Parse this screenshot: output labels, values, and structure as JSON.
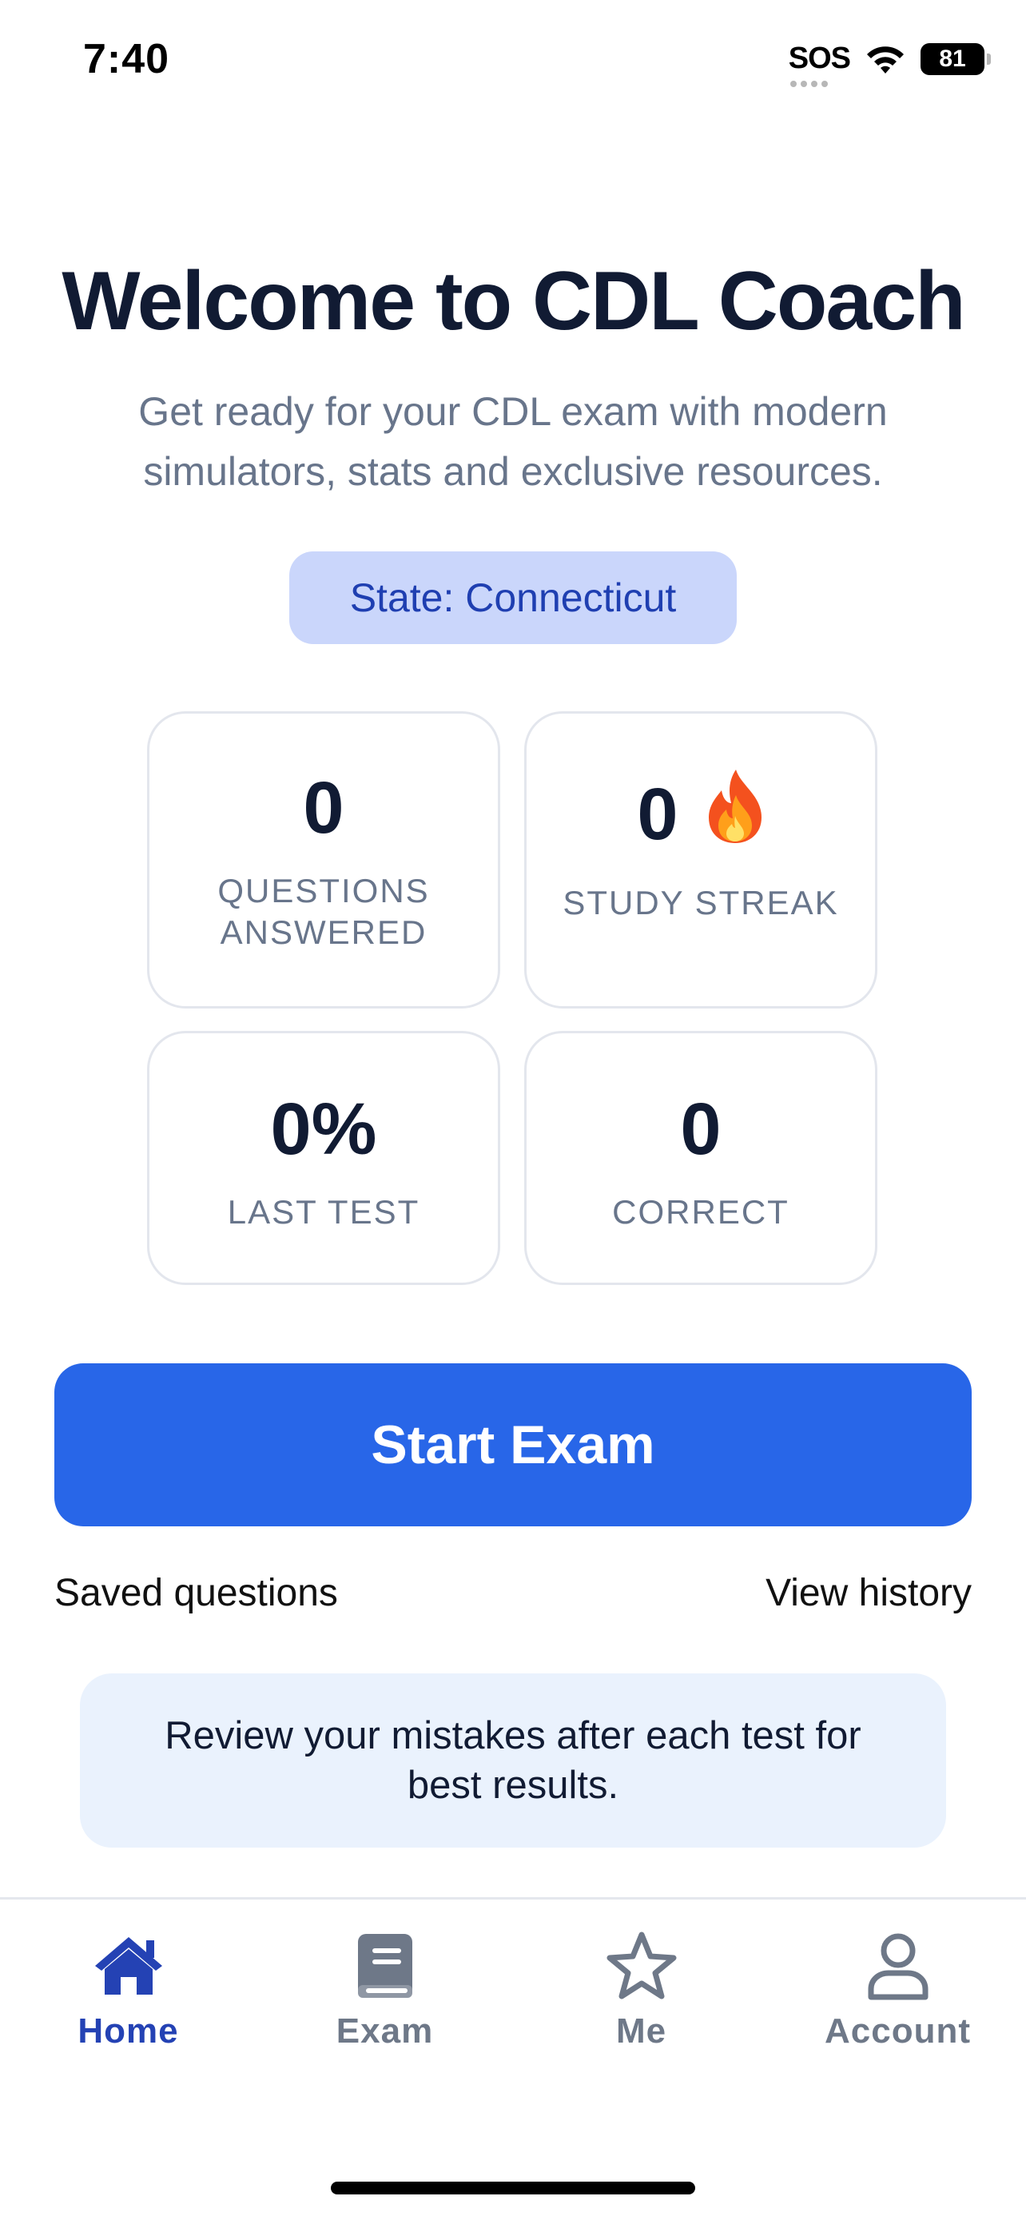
{
  "status_bar": {
    "time": "7:40",
    "sos": "SOS",
    "battery": "81"
  },
  "header": {
    "title": "Welcome to CDL Coach",
    "subtitle": "Get ready for your CDL exam with modern simulators, stats and exclusive resources.",
    "state_pill": "State: Connecticut"
  },
  "stats": [
    {
      "value": "0",
      "label": "QUESTIONS ANSWERED"
    },
    {
      "value": "0",
      "label": "STUDY STREAK",
      "icon": "fire-icon"
    },
    {
      "value": "0%",
      "label": "LAST TEST"
    },
    {
      "value": "0",
      "label": "CORRECT"
    }
  ],
  "actions": {
    "start_exam": "Start Exam",
    "saved_questions": "Saved questions",
    "view_history": "View history"
  },
  "tip": "Review your mistakes after each test for best results.",
  "tab_bar": {
    "active": "Home",
    "items": [
      {
        "label": "Home",
        "icon": "home-icon"
      },
      {
        "label": "Exam",
        "icon": "book-icon"
      },
      {
        "label": "Me",
        "icon": "star-icon"
      },
      {
        "label": "Account",
        "icon": "user-icon"
      }
    ]
  },
  "colors": {
    "primary": "#2866e8",
    "active_tab": "#2442b4",
    "pill_bg": "#cad6fb",
    "tip_bg": "#eaf2fd",
    "muted_text": "#68758b"
  }
}
